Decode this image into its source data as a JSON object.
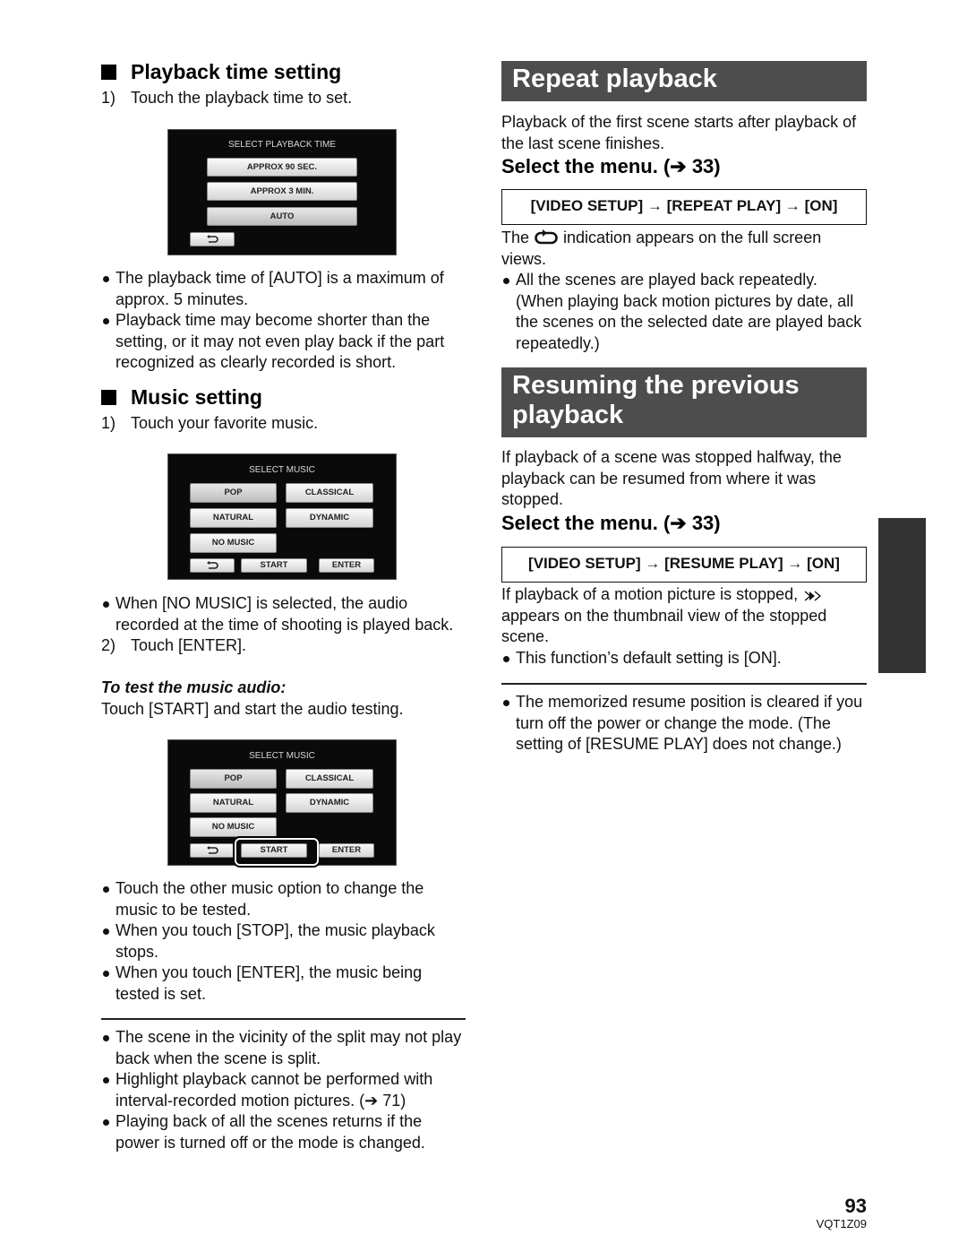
{
  "left": {
    "playback_time": {
      "heading": "Playback time setting",
      "step1_num": "1)",
      "step1": "Touch the playback time to set.",
      "screen": {
        "title": "SELECT PLAYBACK TIME",
        "options": [
          "APPROX 90 SEC.",
          "APPROX 3 MIN.",
          "AUTO"
        ],
        "selected": "AUTO",
        "back_icon": "return-arrow-icon"
      },
      "bullets": [
        "The playback time of [AUTO] is a maximum of approx. 5 minutes.",
        "Playback time may become shorter than the setting, or it may not even play back if the part recognized as clearly recorded is short."
      ]
    },
    "music": {
      "heading": "Music setting",
      "step1_num": "1)",
      "step1": "Touch your favorite music.",
      "screen": {
        "title": "SELECT MUSIC",
        "options": [
          "POP",
          "CLASSICAL",
          "NATURAL",
          "DYNAMIC",
          "NO MUSIC"
        ],
        "selected": "POP",
        "start": "START",
        "enter": "ENTER",
        "back_icon": "return-arrow-icon"
      },
      "bullet1": "When [NO MUSIC] is selected, the audio recorded at the time of shooting is played back.",
      "step2_num": "2)",
      "step2": "Touch [ENTER].",
      "test_heading": "To test the music audio:",
      "test_text": "Touch [START] and start the audio testing.",
      "screen2_highlight": "START",
      "bullets2": [
        "Touch the other music option to change the music to be tested.",
        "When you touch [STOP], the music playback stops.",
        "When you touch [ENTER], the music being tested is set."
      ],
      "notes": [
        "The scene in the vicinity of the split may not play back when the scene is split.",
        "Highlight playback cannot be performed with interval-recorded motion pictures. (➔ 71)",
        "Playing back of all the scenes returns if the power is turned off or the mode is changed."
      ]
    }
  },
  "right": {
    "repeat": {
      "banner": "Repeat playback",
      "intro": "Playback of the first scene starts after playback of the last scene finishes.",
      "select_menu": "Select the menu. (➔ 33)",
      "menu_path": "[VIDEO SETUP] → [REPEAT PLAY] → [ON]",
      "indication_pre": "The",
      "indication_post": "indication appears on the full screen views.",
      "bullet": "All the scenes are played back repeatedly. (When playing back motion pictures by date, all the scenes on the selected date are played back repeatedly.)"
    },
    "resume": {
      "banner": "Resuming the previous playback",
      "intro": "If playback of a scene was stopped halfway, the playback can be resumed from where it was stopped.",
      "select_menu": "Select the menu. (➔ 33)",
      "menu_path": "[VIDEO SETUP] → [RESUME PLAY] → [ON]",
      "stopped_pre": "If playback of a motion picture is stopped,",
      "stopped_post": "appears on the thumbnail view of the stopped scene.",
      "bullet": "This function’s default setting is [ON].",
      "note": "The memorized resume position is cleared if you turn off the power or change the mode. (The setting of [RESUME PLAY] does not change.)"
    }
  },
  "footer": {
    "page_number": "93",
    "code": "VQT1Z09"
  }
}
